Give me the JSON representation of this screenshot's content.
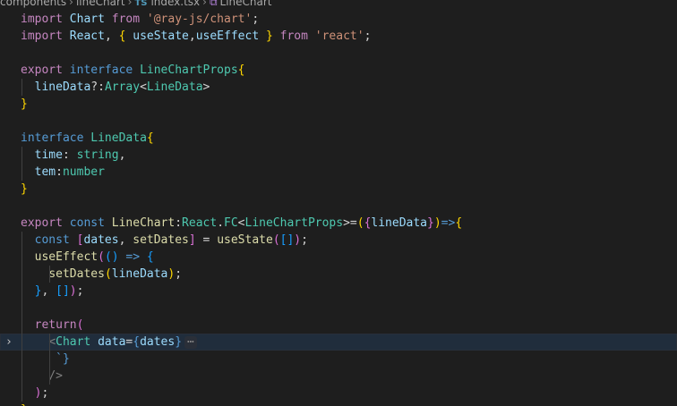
{
  "breadcrumb": {
    "folder_1": "components",
    "folder_2": "lineChart",
    "file_badge": "TS",
    "file_name": "index.tsx",
    "symbol_name": "LineChart"
  },
  "code_lines": [
    [
      [
        "kw",
        "import "
      ],
      [
        "var",
        "Chart "
      ],
      [
        "kw",
        "from "
      ],
      [
        "str",
        "'@ray-js/chart'"
      ],
      [
        "pun",
        ";"
      ]
    ],
    [
      [
        "kw",
        "import "
      ],
      [
        "var",
        "React"
      ],
      [
        "pun",
        ", "
      ],
      [
        "p1",
        "{ "
      ],
      [
        "var",
        "useState"
      ],
      [
        "pun",
        ","
      ],
      [
        "var",
        "useEffect "
      ],
      [
        "p1",
        "} "
      ],
      [
        "kw",
        "from "
      ],
      [
        "str",
        "'react'"
      ],
      [
        "pun",
        ";"
      ]
    ],
    [],
    [
      [
        "kw",
        "export "
      ],
      [
        "st",
        "interface "
      ],
      [
        "ty",
        "LineChartProps"
      ],
      [
        "p1",
        "{"
      ]
    ],
    [
      [
        "pun",
        "  "
      ],
      [
        "var",
        "lineData"
      ],
      [
        "pun",
        "?:"
      ],
      [
        "ty",
        "Array"
      ],
      [
        "pun",
        "<"
      ],
      [
        "ty",
        "LineData"
      ],
      [
        "pun",
        ">"
      ]
    ],
    [
      [
        "p1",
        "}"
      ]
    ],
    [],
    [
      [
        "st",
        "interface "
      ],
      [
        "ty",
        "LineData"
      ],
      [
        "p1",
        "{"
      ]
    ],
    [
      [
        "pun",
        "  "
      ],
      [
        "var",
        "time"
      ],
      [
        "pun",
        ": "
      ],
      [
        "ty",
        "string"
      ],
      [
        "pun",
        ","
      ]
    ],
    [
      [
        "pun",
        "  "
      ],
      [
        "var",
        "tem"
      ],
      [
        "pun",
        ":"
      ],
      [
        "ty",
        "number"
      ]
    ],
    [
      [
        "p1",
        "}"
      ]
    ],
    [],
    [
      [
        "kw",
        "export "
      ],
      [
        "st",
        "const "
      ],
      [
        "fn",
        "LineChart"
      ],
      [
        "pun",
        ":"
      ],
      [
        "ty",
        "React"
      ],
      [
        "pun",
        "."
      ],
      [
        "ty",
        "FC"
      ],
      [
        "pun",
        "<"
      ],
      [
        "ty",
        "LineChartProps"
      ],
      [
        "pun",
        ">="
      ],
      [
        "p1",
        "("
      ],
      [
        "p2",
        "{"
      ],
      [
        "var",
        "lineData"
      ],
      [
        "p2",
        "}"
      ],
      [
        "p1",
        ")"
      ],
      [
        "st",
        "=>"
      ],
      [
        "p1",
        "{"
      ]
    ],
    [
      [
        "pun",
        "  "
      ],
      [
        "st",
        "const "
      ],
      [
        "p2",
        "["
      ],
      [
        "var",
        "dates"
      ],
      [
        "pun",
        ", "
      ],
      [
        "fn",
        "setDates"
      ],
      [
        "p2",
        "]"
      ],
      [
        "pun",
        " = "
      ],
      [
        "fn",
        "useState"
      ],
      [
        "p2",
        "("
      ],
      [
        "p3",
        "[]"
      ],
      [
        "p2",
        ")"
      ],
      [
        "pun",
        ";"
      ]
    ],
    [
      [
        "pun",
        "  "
      ],
      [
        "fn",
        "useEffect"
      ],
      [
        "p2",
        "("
      ],
      [
        "p3",
        "()"
      ],
      [
        "st",
        " => "
      ],
      [
        "p3",
        "{"
      ]
    ],
    [
      [
        "pun",
        "    "
      ],
      [
        "fn",
        "setDates"
      ],
      [
        "p1",
        "("
      ],
      [
        "var",
        "lineData"
      ],
      [
        "p1",
        ")"
      ],
      [
        "pun",
        ";"
      ]
    ],
    [
      [
        "pun",
        "  "
      ],
      [
        "p3",
        "}"
      ],
      [
        "pun",
        ", "
      ],
      [
        "p3",
        "[]"
      ],
      [
        "p2",
        ")"
      ],
      [
        "pun",
        ";"
      ]
    ],
    [],
    [
      [
        "pun",
        "  "
      ],
      [
        "kw",
        "return"
      ],
      [
        "p2",
        "("
      ]
    ],
    [
      [
        "pun",
        "    "
      ],
      [
        "tag",
        "<"
      ],
      [
        "ty",
        "Chart "
      ],
      [
        "var",
        "data"
      ],
      [
        "pun",
        "="
      ],
      [
        "st",
        "{"
      ],
      [
        "var",
        "dates"
      ],
      [
        "st",
        "}"
      ]
    ],
    [
      [
        "pun",
        "     "
      ],
      [
        "st",
        "`}"
      ]
    ],
    [
      [
        "pun",
        "    "
      ],
      [
        "tag",
        "/>"
      ]
    ],
    [
      [
        "pun",
        "  "
      ],
      [
        "p2",
        ")"
      ],
      [
        "pun",
        ";"
      ]
    ],
    [
      [
        "p1",
        "}"
      ]
    ]
  ],
  "folded_marker": "⋯",
  "fold_arrow_icon": "chevron-right-icon"
}
